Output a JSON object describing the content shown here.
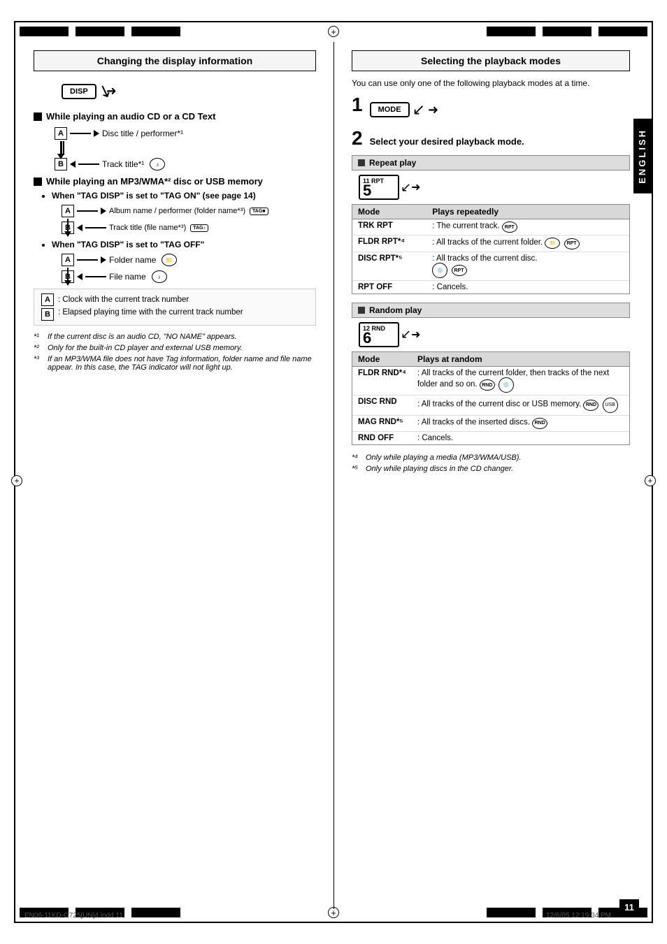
{
  "page": {
    "number": "11",
    "footer_left": "EN06-11KD-G725[UN]4.indd  11",
    "footer_right": "12/6/05  12:19:34 PM",
    "language_tab": "ENGLISH"
  },
  "left_section": {
    "title": "Changing the display information",
    "disp_button": "DISP",
    "audio_cd_heading": "While playing an audio CD or a CD Text",
    "audio_cd_a_label": "A",
    "audio_cd_b_label": "B",
    "audio_cd_a_text": "Disc title / performer*¹",
    "audio_cd_b_text": "Track title*¹",
    "mp3_heading": "While playing an MP3/WMA*² disc or USB memory",
    "tag_on_heading": "When \"TAG DISP\" is set to \"TAG ON\" (see page 14)",
    "tag_on_a_label": "A",
    "tag_on_b_label": "B",
    "tag_on_a_text": "Album name / performer (folder name*³)",
    "tag_on_b_text": "Track title (file name*³)",
    "tag_off_heading": "When \"TAG DISP\" is set to \"TAG OFF\"",
    "tag_off_a_label": "A",
    "tag_off_b_label": "B",
    "tag_off_a_text": "Folder name",
    "tag_off_b_text": "File name",
    "clock_note_a": "A",
    "clock_note_b": "B",
    "clock_note_a_text": ": Clock with the current track number",
    "clock_note_b_text": ": Elapsed playing time with the current track number",
    "footnotes": [
      {
        "num": "*¹",
        "text": "If the current disc is an audio CD, \"NO NAME\" appears."
      },
      {
        "num": "*²",
        "text": "Only for the built-in CD player and external USB memory."
      },
      {
        "num": "*³",
        "text": "If an MP3/WMA file does not have Tag information, folder name and file name appear. In this case, the TAG indicator will not light up."
      }
    ]
  },
  "right_section": {
    "title": "Selecting the playback modes",
    "intro_text": "You can use only one of the following playback modes at a time.",
    "step1_label": "1",
    "mode_button": "MODE",
    "step2_label": "2",
    "step2_text": "Select your desired playback mode.",
    "repeat_play": {
      "heading": "Repeat play",
      "button_top": "11  RPT",
      "button_num": "5",
      "table_header_mode": "Mode",
      "table_header_plays": "Plays repeatedly",
      "rows": [
        {
          "key": "TRK RPT",
          "sep": ":",
          "desc": "The current track."
        },
        {
          "key": "FLDR RPT*⁴",
          "sep": ":",
          "desc": "All tracks of the current folder."
        },
        {
          "key": "DISC RPT*⁵",
          "sep": ":",
          "desc": "All tracks of the current disc."
        },
        {
          "key": "RPT OFF",
          "sep": ":",
          "desc": "Cancels."
        }
      ]
    },
    "random_play": {
      "heading": "Random play",
      "button_top": "12  RND",
      "button_num": "6",
      "table_header_mode": "Mode",
      "table_header_plays": "Plays at random",
      "rows": [
        {
          "key": "FLDR RND*⁴",
          "sep": ":",
          "desc": "All tracks of the current folder, then tracks of the next folder and so on."
        },
        {
          "key": "DISC RND",
          "sep": ":",
          "desc": "All tracks of the current disc or USB memory."
        },
        {
          "key": "MAG RND*⁵",
          "sep": ":",
          "desc": "All tracks of the inserted discs."
        },
        {
          "key": "RND OFF",
          "sep": ":",
          "desc": "Cancels."
        }
      ]
    },
    "footnotes": [
      {
        "num": "*⁴",
        "text": "Only while playing a media (MP3/WMA/USB)."
      },
      {
        "num": "*⁵",
        "text": "Only while playing discs in the CD changer."
      }
    ]
  }
}
